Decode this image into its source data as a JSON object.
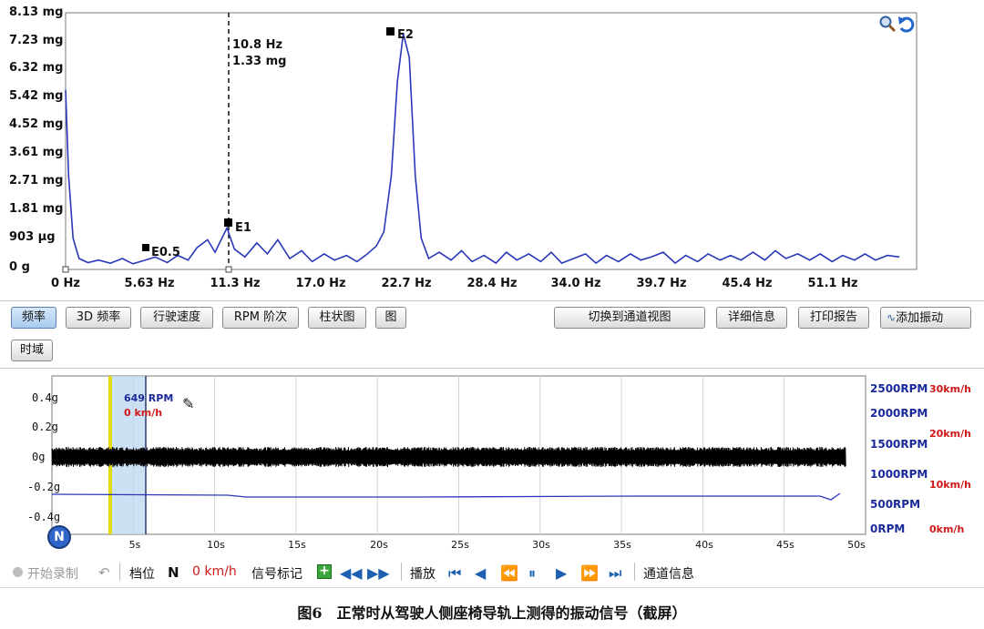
{
  "spectrum": {
    "y_ticks": [
      "8.13 mg",
      "7.23 mg",
      "6.32 mg",
      "5.42 mg",
      "4.52 mg",
      "3.61 mg",
      "2.71 mg",
      "1.81 mg",
      "903 µg",
      "0 g"
    ],
    "x_ticks": [
      "0 Hz",
      "5.63 Hz",
      "11.3 Hz",
      "17.0 Hz",
      "22.7 Hz",
      "28.4 Hz",
      "34.0 Hz",
      "39.7 Hz",
      "45.4 Hz",
      "51.1 Hz"
    ],
    "cursor_freq": "10.8 Hz",
    "cursor_amp": "1.33 mg",
    "markers": {
      "e05": "E0.5",
      "e1": "E1",
      "e2": "E2"
    },
    "trace_color": "#2a38b8",
    "curve": [
      [
        0,
        5.75
      ],
      [
        0.2,
        3.0
      ],
      [
        0.5,
        1.0
      ],
      [
        0.9,
        0.35
      ],
      [
        1.5,
        0.22
      ],
      [
        2.2,
        0.3
      ],
      [
        3.0,
        0.2
      ],
      [
        3.8,
        0.35
      ],
      [
        4.5,
        0.18
      ],
      [
        5.2,
        0.28
      ],
      [
        6.0,
        0.4
      ],
      [
        6.8,
        0.22
      ],
      [
        7.5,
        0.45
      ],
      [
        8.2,
        0.3
      ],
      [
        8.8,
        0.7
      ],
      [
        9.5,
        0.95
      ],
      [
        10.0,
        0.55
      ],
      [
        10.8,
        1.33
      ],
      [
        11.3,
        0.65
      ],
      [
        12.0,
        0.4
      ],
      [
        12.8,
        0.85
      ],
      [
        13.5,
        0.5
      ],
      [
        14.2,
        0.95
      ],
      [
        15.0,
        0.35
      ],
      [
        15.8,
        0.6
      ],
      [
        16.5,
        0.25
      ],
      [
        17.3,
        0.5
      ],
      [
        18.0,
        0.3
      ],
      [
        18.8,
        0.45
      ],
      [
        19.5,
        0.25
      ],
      [
        20.2,
        0.5
      ],
      [
        20.8,
        0.75
      ],
      [
        21.3,
        1.2
      ],
      [
        21.8,
        3.0
      ],
      [
        22.2,
        6.0
      ],
      [
        22.6,
        7.55
      ],
      [
        23.0,
        6.8
      ],
      [
        23.4,
        3.0
      ],
      [
        23.8,
        1.0
      ],
      [
        24.3,
        0.35
      ],
      [
        25.0,
        0.55
      ],
      [
        25.8,
        0.3
      ],
      [
        26.5,
        0.6
      ],
      [
        27.2,
        0.25
      ],
      [
        28.0,
        0.45
      ],
      [
        28.8,
        0.2
      ],
      [
        29.5,
        0.55
      ],
      [
        30.2,
        0.3
      ],
      [
        31.0,
        0.5
      ],
      [
        31.8,
        0.25
      ],
      [
        32.5,
        0.55
      ],
      [
        33.2,
        0.2
      ],
      [
        34.0,
        0.35
      ],
      [
        34.8,
        0.5
      ],
      [
        35.5,
        0.2
      ],
      [
        36.2,
        0.45
      ],
      [
        37.0,
        0.25
      ],
      [
        37.8,
        0.5
      ],
      [
        38.5,
        0.3
      ],
      [
        39.2,
        0.4
      ],
      [
        40.0,
        0.55
      ],
      [
        40.8,
        0.2
      ],
      [
        41.5,
        0.45
      ],
      [
        42.3,
        0.25
      ],
      [
        43.0,
        0.5
      ],
      [
        43.8,
        0.3
      ],
      [
        44.5,
        0.45
      ],
      [
        45.2,
        0.3
      ],
      [
        46.0,
        0.55
      ],
      [
        46.8,
        0.3
      ],
      [
        47.5,
        0.6
      ],
      [
        48.2,
        0.35
      ],
      [
        49.0,
        0.5
      ],
      [
        49.8,
        0.3
      ],
      [
        50.5,
        0.5
      ],
      [
        51.3,
        0.25
      ],
      [
        52.0,
        0.45
      ],
      [
        52.8,
        0.3
      ],
      [
        53.5,
        0.5
      ],
      [
        54.2,
        0.3
      ],
      [
        55.0,
        0.45
      ],
      [
        55.8,
        0.4
      ]
    ]
  },
  "toolbar": {
    "freq": "频率",
    "freq3d": "3D 频率",
    "speed": "行驶速度",
    "rpm_order": "RPM 阶次",
    "bar": "柱状图",
    "graph": "图",
    "switch_view": "切换到通道视图",
    "details": "详细信息",
    "print": "打印报告",
    "add_vib": "添加振动",
    "time_domain": "时域"
  },
  "timechart": {
    "y_ticks": [
      "0.4g",
      "0.2g",
      "0g",
      "-0.2g",
      "-0.4g"
    ],
    "x_ticks": [
      "5s",
      "10s",
      "15s",
      "20s",
      "25s",
      "30s",
      "35s",
      "40s",
      "45s",
      "50s"
    ],
    "rpm_ticks": [
      "2500RPM",
      "2000RPM",
      "1500RPM",
      "1000RPM",
      "500RPM",
      "0RPM"
    ],
    "kmh_ticks": [
      "30km/h",
      "20km/h",
      "10km/h",
      "0km/h"
    ],
    "cursor_rpm": "649 RPM",
    "cursor_kmh": "0 km/h",
    "gear_badge": "N"
  },
  "statusbar": {
    "record": "开始录制",
    "gear_label": "档位",
    "gear_value": "N",
    "speed_value": "0 km/h",
    "signal_mark": "信号标记",
    "play": "播放",
    "channel_info": "通道信息"
  },
  "caption": "图6　正常时从驾驶人侧座椅导轨上测得的振动信号（截屏）"
}
